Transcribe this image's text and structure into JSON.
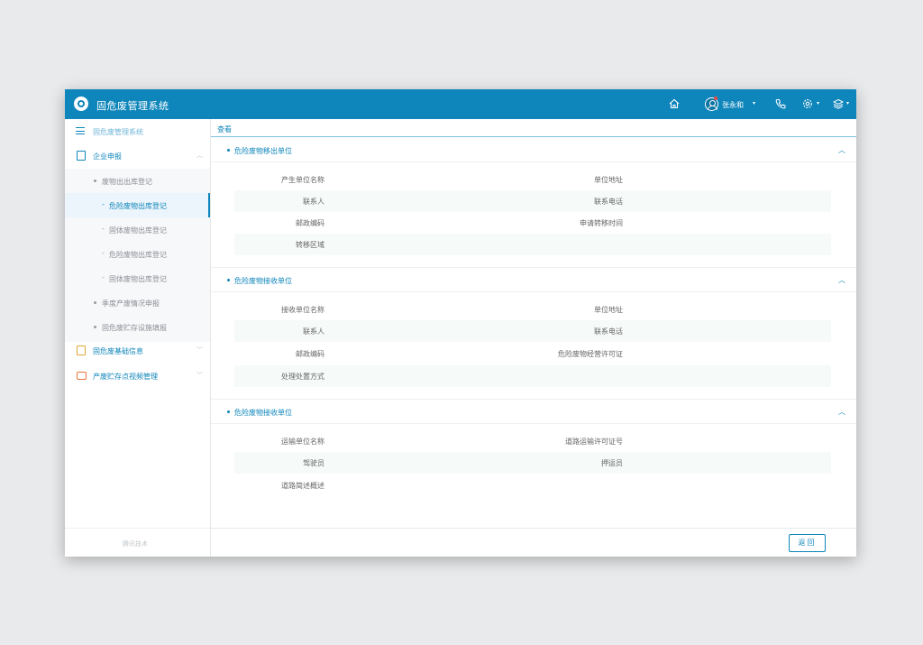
{
  "header": {
    "app_title": "固危废管理系统",
    "user_name": "张永和",
    "caret": "▾",
    "icons": [
      "home-icon",
      "avatar-icon",
      "phone-icon",
      "gear-icon",
      "layers-icon"
    ]
  },
  "sidebar": {
    "system_label": "固危废管理系统",
    "corp_label": "企业申报",
    "sub_items": [
      {
        "label": "废物出出库登记",
        "level": 2
      },
      {
        "label": "危险废物出库登记",
        "level": 3,
        "active": true
      },
      {
        "label": "固体废物出库登记",
        "level": 3
      },
      {
        "label": "危险废物出库登记",
        "level": 3
      },
      {
        "label": "固体废物出库登记",
        "level": 3
      },
      {
        "label": "季度产废情况申报",
        "level": 2
      },
      {
        "label": "固危废贮存设施填报",
        "level": 2
      }
    ],
    "base_label": "固危废基础信息",
    "video_label": "产废贮存点视频管理",
    "footer": "腾讯技术",
    "chevron_up": "︿",
    "chevron_down": "﹀",
    "dash": "-"
  },
  "main": {
    "crumb": "查看",
    "collapse_icon": "︿",
    "sections": [
      {
        "title": "危险废物移出单位",
        "rows": [
          [
            "产生单位名称",
            "单位地址"
          ],
          [
            "联系人",
            "联系电话"
          ],
          [
            "邮政编码",
            "申请转移时间"
          ],
          [
            "转移区域",
            ""
          ]
        ]
      },
      {
        "title": "危险废物接收单位",
        "rows": [
          [
            "接收单位名称",
            "单位地址"
          ],
          [
            "联系人",
            "联系电话"
          ],
          [
            "邮政编码",
            "危险废物经营许可证"
          ],
          [
            "处理处置方式",
            ""
          ]
        ]
      },
      {
        "title": "危险废物接收单位",
        "rows": [
          [
            "运输单位名称",
            "道路运输许可证号"
          ],
          [
            "驾驶员",
            "押运员"
          ],
          [
            "道路简述概述",
            ""
          ]
        ]
      }
    ],
    "back_button": "返回"
  },
  "colors": {
    "primary": "#0f86bb",
    "header_bg": "#0f86bb",
    "row_alt": "#f6faf9",
    "warning_icon": "#e0a633",
    "video_icon": "#e8743a",
    "badge": "#e94b4b"
  }
}
